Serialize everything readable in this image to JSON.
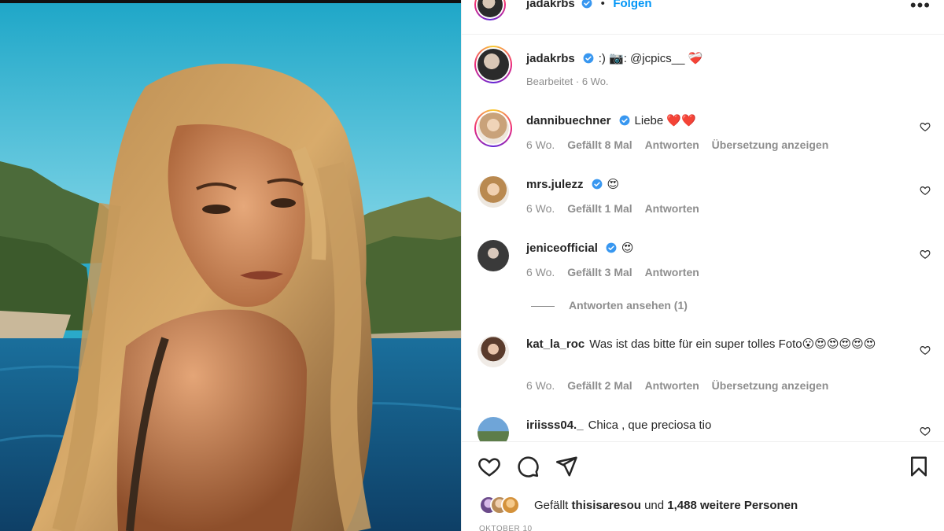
{
  "post": {
    "author": "jadakrbs",
    "follow_label": "Folgen",
    "separator": "•",
    "more_label": "•••"
  },
  "caption": {
    "username": "jadakrbs",
    "text": ":) 📷: @jcpics__ ❤️‍🩹",
    "meta": "Bearbeitet · 6 Wo."
  },
  "comments": [
    {
      "username": "dannibuechner",
      "verified": true,
      "text": "Liebe ❤️❤️",
      "age": "6 Wo.",
      "likes": "Gefällt 8 Mal",
      "reply": "Antworten",
      "translate": "Übersetzung anzeigen"
    },
    {
      "username": "mrs.julezz",
      "verified": true,
      "text": "😍",
      "age": "6 Wo.",
      "likes": "Gefällt 1 Mal",
      "reply": "Antworten"
    },
    {
      "username": "jeniceofficial",
      "verified": true,
      "text": "😍",
      "age": "6 Wo.",
      "likes": "Gefällt 3 Mal",
      "reply": "Antworten",
      "view_replies": "Antworten ansehen (1)"
    },
    {
      "username": "kat_la_roc",
      "verified": false,
      "text": "Was ist das bitte für ein super tolles Foto😮😍😍😍😍😍",
      "age": "6 Wo.",
      "likes": "Gefällt 2 Mal",
      "reply": "Antworten",
      "translate": "Übersetzung anzeigen"
    },
    {
      "username": "iriisss04._",
      "verified": false,
      "text": "Chica , que preciosa tio"
    }
  ],
  "likes_summary": {
    "prefix": "Gefällt",
    "user": "thisisaresou",
    "middle": "und",
    "count": "1,488 weitere Personen"
  },
  "date": "OKTOBER 10",
  "icons": {
    "verified": "verified-badge-icon",
    "like": "heart-icon",
    "comment": "comment-icon",
    "share": "share-icon",
    "save": "bookmark-icon",
    "more": "more-icon"
  },
  "colors": {
    "accent": "#0095f6",
    "verified": "#3897f0",
    "muted": "#8e8e8e",
    "text": "#262626",
    "heart_red": "#ed4956"
  }
}
